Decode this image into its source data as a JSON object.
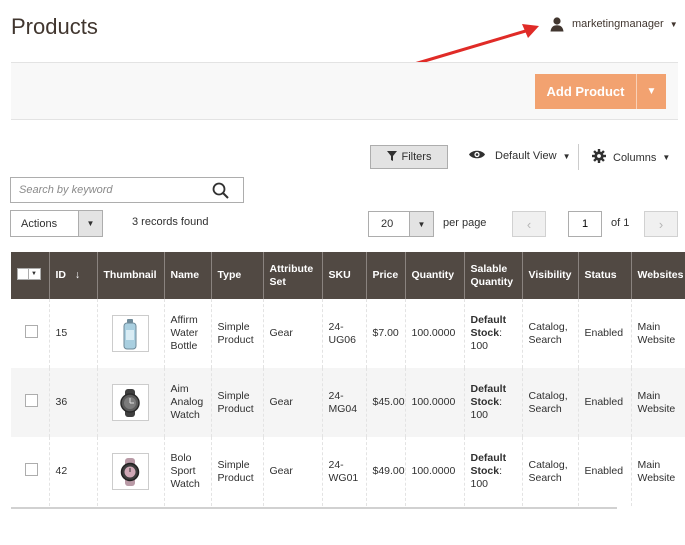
{
  "header": {
    "title": "Products",
    "user": "marketingmanager"
  },
  "page_actions": {
    "add_product": "Add Product"
  },
  "toolbar": {
    "filters": "Filters",
    "view": "Default View",
    "columns": "Columns",
    "search_placeholder": "Search by keyword",
    "actions": "Actions",
    "records_found": "3 records found",
    "per_page_value": "20",
    "per_page_label": "per page",
    "page_current": "1",
    "page_of": "of 1"
  },
  "colors": {
    "accent": "#f2a270",
    "header_bg": "#514943",
    "annotation_arrow": "#e02b27"
  },
  "grid": {
    "columns": [
      "ID",
      "Thumbnail",
      "Name",
      "Type",
      "Attribute Set",
      "SKU",
      "Price",
      "Quantity",
      "Salable Quantity",
      "Visibility",
      "Status",
      "Websites"
    ],
    "id_sort_indicator": "↓",
    "rows": [
      {
        "id": "15",
        "thumbnail_icon": "water-bottle-thumbnail",
        "name": "Affirm Water Bottle",
        "type": "Simple Product",
        "attribute_set": "Gear",
        "sku": "24-UG06",
        "price": "$7.00",
        "quantity": "100.0000",
        "salable_stock": "Default Stock",
        "salable_qty": ": 100",
        "visibility": "Catalog, Search",
        "status": "Enabled",
        "websites": "Main Website"
      },
      {
        "id": "36",
        "thumbnail_icon": "analog-watch-thumbnail",
        "name": "Aim Analog Watch",
        "type": "Simple Product",
        "attribute_set": "Gear",
        "sku": "24-MG04",
        "price": "$45.00",
        "quantity": "100.0000",
        "salable_stock": "Default Stock",
        "salable_qty": ": 100",
        "visibility": "Catalog, Search",
        "status": "Enabled",
        "websites": "Main Website"
      },
      {
        "id": "42",
        "thumbnail_icon": "sport-watch-thumbnail",
        "name": "Bolo Sport Watch",
        "type": "Simple Product",
        "attribute_set": "Gear",
        "sku": "24-WG01",
        "price": "$49.00",
        "quantity": "100.0000",
        "salable_stock": "Default Stock",
        "salable_qty": ": 100",
        "visibility": "Catalog, Search",
        "status": "Enabled",
        "websites": "Main Website"
      }
    ]
  }
}
